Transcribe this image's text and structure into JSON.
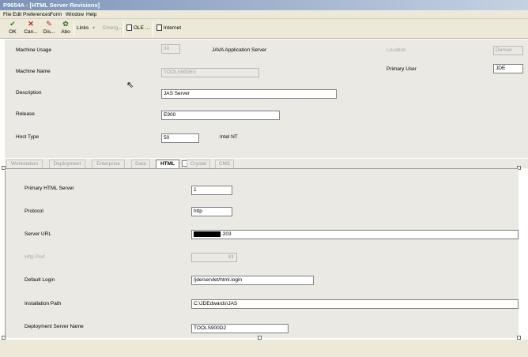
{
  "window": {
    "title": "P9654A - [HTML Server Revisions]"
  },
  "menu": [
    "File",
    "Edit",
    "Preferences",
    "Form",
    "Window",
    "Help"
  ],
  "toolbar": {
    "ok": {
      "label": "OK",
      "icon": "check-icon"
    },
    "cancel": {
      "label": "Can...",
      "icon": "x-icon"
    },
    "display": {
      "label": "Dis...",
      "icon": "pin-icon"
    },
    "about": {
      "label": "Abo",
      "icon": "about-icon"
    },
    "links": "Links",
    "emerg": "Emerg...",
    "ole": "OLE ...",
    "internet": "Internet"
  },
  "header": {
    "machine_usage": {
      "label": "Machine Usage",
      "value": "30",
      "desc": "JAVA Application Server"
    },
    "location": {
      "label": "Location",
      "value": "Denver"
    },
    "machine_name": {
      "label": "Machine Name",
      "value": "TOOLS900E3"
    },
    "primary_user": {
      "label": "Primary User",
      "value": "JDE"
    },
    "description": {
      "label": "Description",
      "value": "JAS Server"
    },
    "release": {
      "label": "Release",
      "value": "E900"
    },
    "host_type": {
      "label": "Host Type",
      "value": "50",
      "desc": "Intel NT"
    }
  },
  "tabs": [
    "Workstation",
    "Deployment",
    "Enterprise",
    "Data",
    "HTML",
    "Crystal",
    "CMS"
  ],
  "active_tab": "HTML",
  "html_tab": {
    "primary_server": {
      "label": "Primary HTML Server",
      "value": "1"
    },
    "protocol": {
      "label": "Protocol",
      "value": "http"
    },
    "server_url": {
      "label": "Server URL",
      "value": ".203"
    },
    "http_port": {
      "label": "Http Port",
      "value": "81"
    },
    "default_login": {
      "label": "Default Login",
      "value": "/jde/servlet/html.login"
    },
    "install_path": {
      "label": "Installation Path",
      "value": "C:\\JDEdwards\\JAS"
    },
    "deploy_server": {
      "label": "Deployment Server Name",
      "value": "TOOLS900D2"
    }
  }
}
